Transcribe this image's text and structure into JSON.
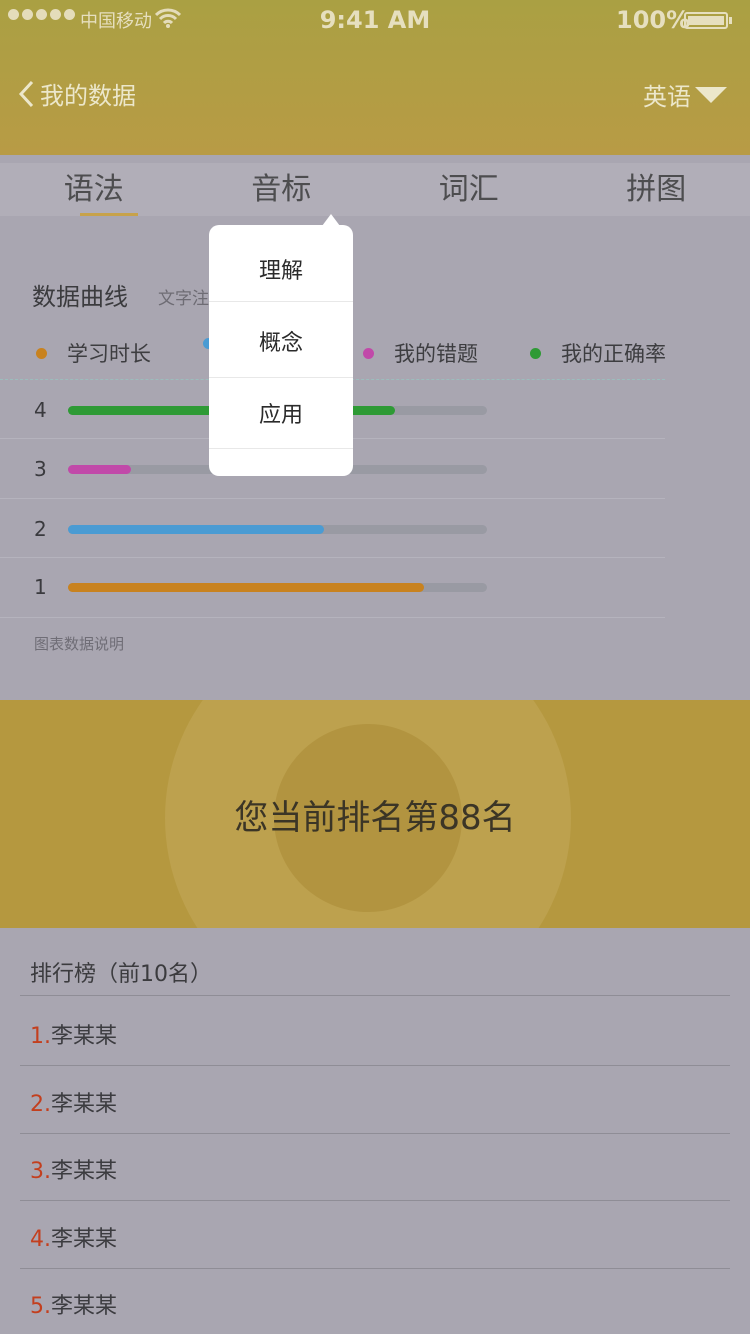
{
  "status_bar": {
    "carrier": "中国移动",
    "time": "9:41 AM",
    "battery": "100%"
  },
  "nav": {
    "back_label": "我的数据",
    "language": "英语"
  },
  "tabs": [
    {
      "label": "语法",
      "active": true
    },
    {
      "label": "音标",
      "active": false
    },
    {
      "label": "词汇",
      "active": false
    },
    {
      "label": "拼图",
      "active": false
    }
  ],
  "chart_section": {
    "title": "数据曲线",
    "subtitle": "文字注",
    "legend": [
      {
        "label": "学习时长",
        "color": "#c8821f"
      },
      {
        "label": "",
        "color": "#4a9bd3"
      },
      {
        "label": "我的错题",
        "color": "#c149a9"
      },
      {
        "label": "我的正确率",
        "color": "#2e9a35"
      }
    ],
    "note": "图表数据说明"
  },
  "chart_data": {
    "type": "bar",
    "orientation": "horizontal",
    "categories": [
      "4",
      "3",
      "2",
      "1"
    ],
    "values": [
      0.78,
      0.15,
      0.61,
      0.85
    ],
    "colors": [
      "#2e9a35",
      "#c149a9",
      "#4a9bd3",
      "#c8821f"
    ],
    "xlim": [
      0,
      1
    ]
  },
  "popup_menu": {
    "items": [
      "理解",
      "概念",
      "应用"
    ]
  },
  "banner": {
    "rank_text": "您当前排名第88名"
  },
  "leaderboard": {
    "title": "排行榜（前10名）",
    "items": [
      {
        "rank": "1.",
        "name": "李某某"
      },
      {
        "rank": "2.",
        "name": "李某某"
      },
      {
        "rank": "3.",
        "name": "李某某"
      },
      {
        "rank": "4.",
        "name": "李某某"
      },
      {
        "rank": "5.",
        "name": "李某某"
      }
    ]
  }
}
